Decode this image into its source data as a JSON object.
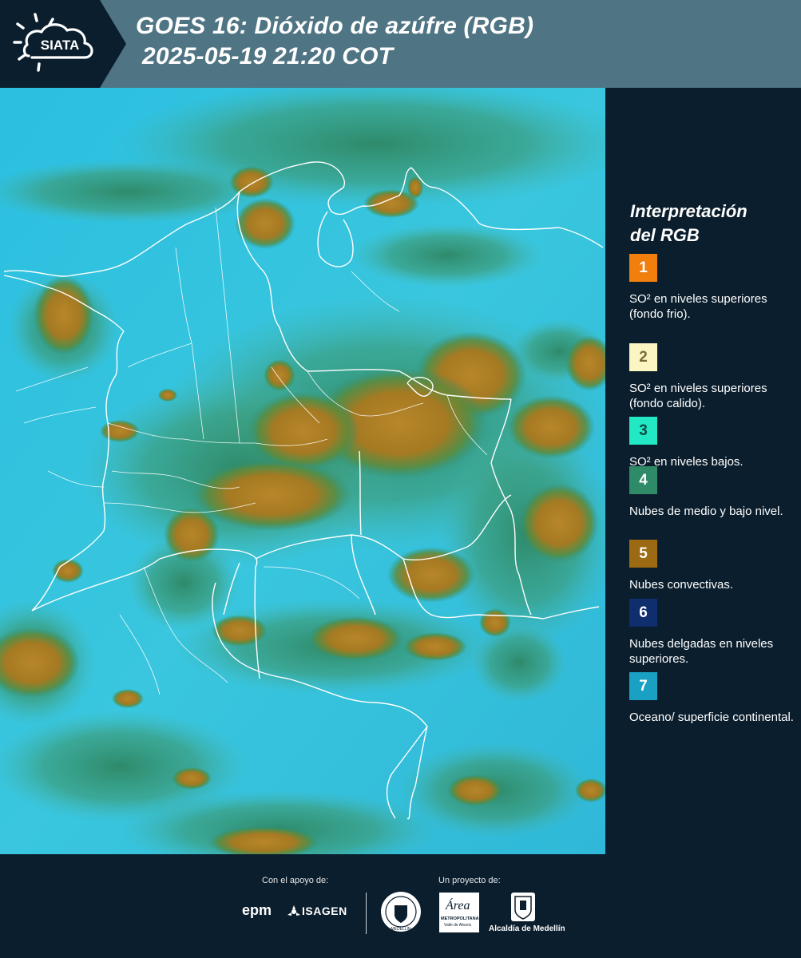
{
  "header": {
    "logo_text": "SIATA",
    "title_line1": "GOES 16: Dióxido de azúfre (RGB)",
    "title_line2": "2025-05-19 21:20 COT"
  },
  "legend": {
    "title_line1": "Interpretación",
    "title_line2": "del RGB",
    "items": [
      {
        "num": "1",
        "label": "SO² en niveles superiores (fondo frio).",
        "color": "#f07f0d"
      },
      {
        "num": "2",
        "label": "SO² en niveles superiores (fondo calido).",
        "color": "#fbf5c2"
      },
      {
        "num": "3",
        "label": "SO² en niveles bajos.",
        "color": "#22e8c4"
      },
      {
        "num": "4",
        "label": "Nubes de medio y bajo nivel.",
        "color": "#2f8a68"
      },
      {
        "num": "5",
        "label": "Nubes convectivas.",
        "color": "#9c6a12"
      },
      {
        "num": "6",
        "label": "Nubes delgadas en niveles superiores.",
        "color": "#0f2e6e"
      },
      {
        "num": "7",
        "label": "Oceano/ superficie continental.",
        "color": "#1aa0c2"
      }
    ]
  },
  "footer": {
    "support_label": "Con el apoyo de:",
    "project_label": "Un proyecto de:",
    "sponsor_epm": "epm",
    "sponsor_isagen": "ISAGEN",
    "seal_text": "MEDELLÍN",
    "metro_name": "Área",
    "metro_sub1": "METROPOLITANA",
    "metro_sub2": "Valle de Aburrá",
    "alcaldia": "Alcaldía de Medellín"
  }
}
